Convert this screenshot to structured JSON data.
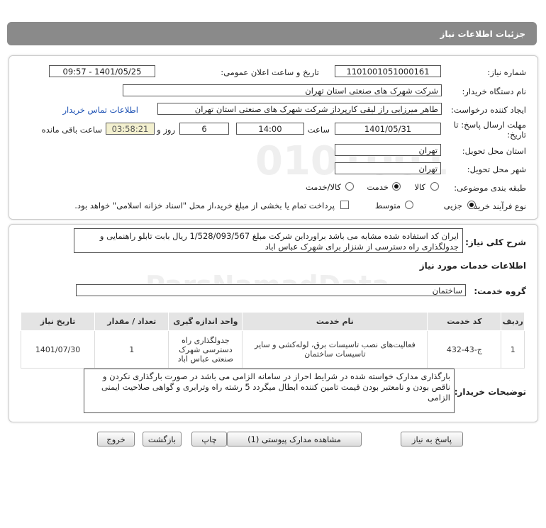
{
  "header": {
    "title": "جزئیات اطلاعات نیاز"
  },
  "form": {
    "need_number": {
      "label": "شماره نیاز:",
      "value": "1101001051000161"
    },
    "announce_datetime": {
      "label": "تاریخ و ساعت اعلان عمومی:",
      "value": "1401/05/25 - 09:57"
    },
    "buyer_org": {
      "label": "نام دستگاه خریدار:",
      "value": "شرکت شهرک های صنعتی استان تهران"
    },
    "requester": {
      "label": "ایجاد کننده درخواست:",
      "value": "طاهر  میرزایی راز لیقی کارپرداز شرکت شهرک های صنعتی استان تهران"
    },
    "contact_link": "اطلاعات تماس خریدار",
    "deadline": {
      "label_line1": "مهلت ارسال پاسخ: تا",
      "label_line2": "تاریخ:",
      "date": "1401/05/31",
      "time_label": "ساعت",
      "time": "14:00",
      "days": "6",
      "days_label": "روز و",
      "remaining": "03:58:21",
      "remaining_label": "ساعت باقی مانده"
    },
    "delivery_province": {
      "label": "استان محل تحویل:",
      "value": "تهران"
    },
    "delivery_city": {
      "label": "شهر محل تحویل:",
      "value": "تهران"
    },
    "category": {
      "label": "طبقه بندی موضوعی:",
      "options": [
        "کالا",
        "خدمت",
        "کالا/خدمت"
      ],
      "selected": "خدمت"
    },
    "purchase_type": {
      "label": "نوع فرآیند خرید :",
      "options": [
        "جزیی",
        "متوسط"
      ],
      "selected": "جزیی",
      "treasury_note": "پرداخت تمام یا بخشی از مبلغ خرید،از محل \"اسناد خزانه اسلامی\" خواهد بود."
    }
  },
  "details": {
    "summary_label": "شرح کلی نیاز:",
    "summary_text": "ایران کد استفاده شده مشابه می باشد براوردابن شرکت مبلغ 1/528/093/567 ریال بابت تابلو راهنمایی و جدولگذاری راه دسترسی از شنزار برای شهرک عباس اباد",
    "services_title": "اطلاعات خدمات مورد نیاز",
    "service_group": {
      "label": "گروه خدمت:",
      "value": "ساختمان"
    },
    "table": {
      "headers": [
        "ردیف",
        "کد خدمت",
        "نام خدمت",
        "واحد اندازه گیری",
        "تعداد / مقدار",
        "تاریخ نیاز"
      ],
      "rows": [
        [
          "1",
          "ج-43-432",
          "فعالیت‌های نصب تاسیسات برق، لوله‌کشی و سایر تاسیسات ساختمان",
          "جدولگذاری راه دسترسی شهرک صنعتی عباس اباد",
          "1",
          "1401/07/30"
        ]
      ]
    },
    "buyer_notes_label": "توضیحات خریدار:",
    "buyer_notes_text": "بارگذاری مدارک خواسته شده در شرایط احراز در سامانه الزامی می باشد در صورت بارگذاری نکردن و ناقص بودن و نامعتبر بودن قیمت تامین کننده ابطال میگردد 5 رشته راه وترابری و گواهی صلاحیت ایمنی الزامی"
  },
  "buttons": {
    "reply": "پاسخ به نیاز",
    "view_docs": "مشاهده مدارک پیوستی (1)",
    "print": "چاپ",
    "back": "بازگشت",
    "exit": "خروج"
  }
}
